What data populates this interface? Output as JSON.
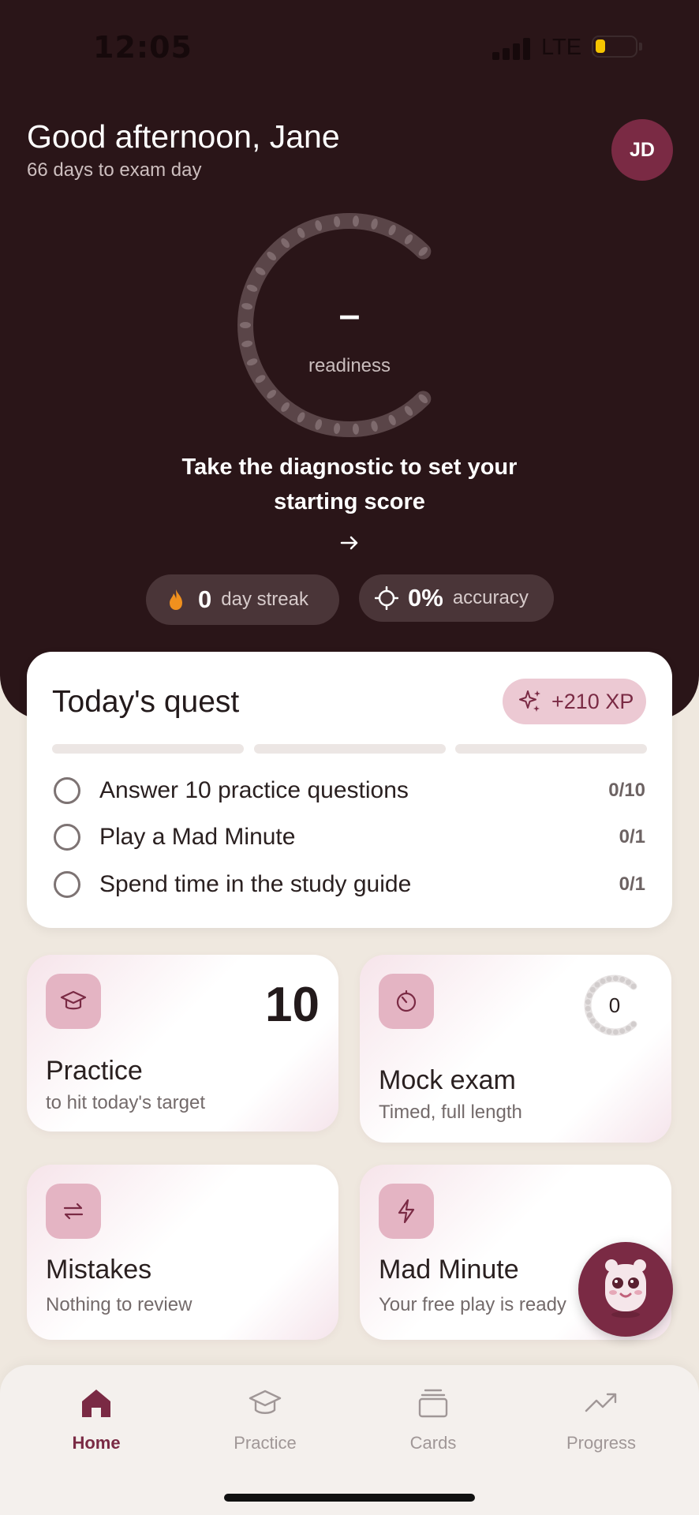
{
  "status_bar": {
    "time": "12:05",
    "network": "LTE"
  },
  "hero": {
    "greeting": "Good afternoon, Jane",
    "subtitle": "66 days to exam day",
    "avatar_initials": "JD",
    "readiness_value": "–",
    "readiness_label": "readiness",
    "cta_text": "Take the diagnostic to set your starting score",
    "streak": {
      "value": "0",
      "label": "day streak",
      "icon": "flame-icon"
    },
    "accuracy": {
      "value": "0%",
      "label": "accuracy",
      "icon": "target-icon"
    }
  },
  "quest": {
    "title": "Today's quest",
    "xp": "+210 XP",
    "items": [
      {
        "label": "Answer 10 practice questions",
        "count": "0/10"
      },
      {
        "label": "Play a Mad Minute",
        "count": "0/1"
      },
      {
        "label": "Spend time in the study guide",
        "count": "0/1"
      }
    ]
  },
  "cards": {
    "practice": {
      "title": "Practice",
      "subtitle": "to hit today's target",
      "value": "10",
      "icon": "graduation-cap-icon"
    },
    "mock_exam": {
      "title": "Mock exam",
      "subtitle": "Timed, full length",
      "value": "0",
      "icon": "timer-icon"
    },
    "mistakes": {
      "title": "Mistakes",
      "subtitle": "Nothing to review",
      "icon": "repeat-icon"
    },
    "mad_minute": {
      "title": "Mad Minute",
      "subtitle": "Your free play is ready",
      "icon": "lightning-icon"
    }
  },
  "tabs": [
    {
      "label": "Home",
      "icon": "home-icon",
      "active": true
    },
    {
      "label": "Practice",
      "icon": "graduation-cap-icon",
      "active": false
    },
    {
      "label": "Cards",
      "icon": "cards-icon",
      "active": false
    },
    {
      "label": "Progress",
      "icon": "trending-up-icon",
      "active": false
    }
  ],
  "colors": {
    "hero_bg": "#2a1518",
    "accent": "#7a2a44",
    "badge_bg": "#ecc9d3"
  }
}
